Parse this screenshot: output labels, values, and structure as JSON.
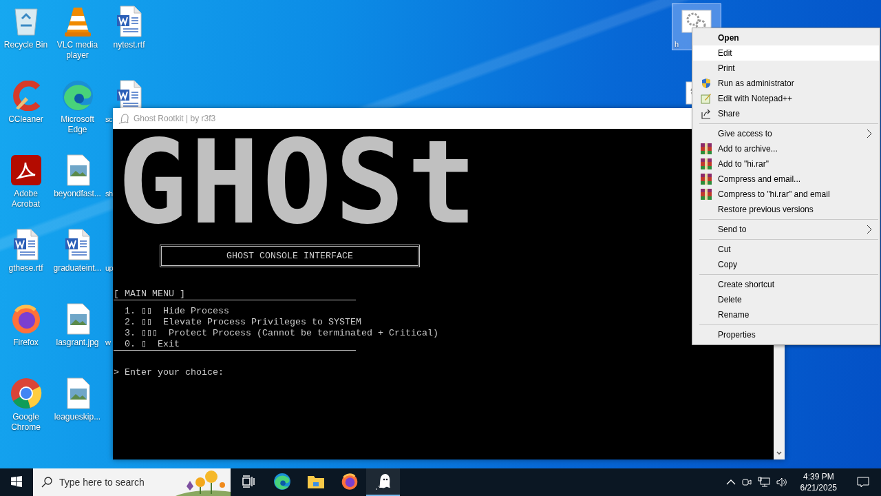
{
  "desktop_icons": [
    {
      "label": "Recycle Bin",
      "kind": "recycle",
      "cut": false
    },
    {
      "label": "CCleaner",
      "kind": "ccleaner",
      "cut": false
    },
    {
      "label": "Adobe Acrobat",
      "kind": "pdf",
      "cut": false
    },
    {
      "label": "gthese.rtf",
      "kind": "word",
      "cut": false
    },
    {
      "label": "Firefox",
      "kind": "firefox",
      "cut": false
    },
    {
      "label": "Google Chrome",
      "kind": "chrome",
      "cut": false
    },
    {
      "label": "VLC media player",
      "kind": "vlc",
      "cut": false
    },
    {
      "label": "Microsoft Edge",
      "kind": "edge",
      "cut": false
    },
    {
      "label": "beyondfast...",
      "kind": "image",
      "cut": false
    },
    {
      "label": "graduateint...",
      "kind": "word",
      "cut": false
    },
    {
      "label": "lasgrant.jpg",
      "kind": "image",
      "cut": false
    },
    {
      "label": "leagueskip...",
      "kind": "image",
      "cut": false
    },
    {
      "label": "nytest.rtf",
      "kind": "word",
      "cut": false
    },
    {
      "label": "sc",
      "kind": "word",
      "cut": true
    },
    {
      "label": "sh",
      "kind": "none",
      "cut": true
    },
    {
      "label": "up",
      "kind": "none",
      "cut": true
    },
    {
      "label": "w",
      "kind": "none",
      "cut": true
    }
  ],
  "selected_file": {
    "label": "h",
    "selected": true
  },
  "console": {
    "title": "Ghost Rootkit | by r3f3",
    "banner": "GHOSt",
    "header": "GHOST CONSOLE INTERFACE",
    "menu_title": "[ MAIN MENU ]",
    "menu_items": [
      "1. ▯▯  Hide Process",
      "2. ▯▯  Elevate Process Privileges to SYSTEM",
      "3. ▯▯▯  Protect Process (Cannot be terminated + Critical)",
      "0. ▯  Exit"
    ],
    "prompt": "> Enter your choice:"
  },
  "context_menu": {
    "groups": [
      [
        {
          "label": "Open",
          "kind": "plain",
          "bold": true,
          "selected": false,
          "submenu": false
        },
        {
          "label": "Edit",
          "kind": "plain",
          "bold": false,
          "selected": true,
          "submenu": false
        },
        {
          "label": "Print",
          "kind": "plain",
          "bold": false,
          "selected": false,
          "submenu": false
        },
        {
          "label": "Run as administrator",
          "kind": "shield",
          "bold": false,
          "selected": false,
          "submenu": false
        },
        {
          "label": "Edit with Notepad++",
          "kind": "notepad",
          "bold": false,
          "selected": false,
          "submenu": false
        },
        {
          "label": "Share",
          "kind": "share",
          "bold": false,
          "selected": false,
          "submenu": false
        }
      ],
      [
        {
          "label": "Give access to",
          "kind": "plain",
          "bold": false,
          "selected": false,
          "submenu": true
        },
        {
          "label": "Add to archive...",
          "kind": "rar",
          "bold": false,
          "selected": false,
          "submenu": false
        },
        {
          "label": "Add to \"hi.rar\"",
          "kind": "rar",
          "bold": false,
          "selected": false,
          "submenu": false
        },
        {
          "label": "Compress and email...",
          "kind": "rar",
          "bold": false,
          "selected": false,
          "submenu": false
        },
        {
          "label": "Compress to \"hi.rar\" and email",
          "kind": "rar",
          "bold": false,
          "selected": false,
          "submenu": false
        },
        {
          "label": "Restore previous versions",
          "kind": "plain",
          "bold": false,
          "selected": false,
          "submenu": false
        }
      ],
      [
        {
          "label": "Send to",
          "kind": "plain",
          "bold": false,
          "selected": false,
          "submenu": true
        }
      ],
      [
        {
          "label": "Cut",
          "kind": "plain",
          "bold": false,
          "selected": false,
          "submenu": false
        },
        {
          "label": "Copy",
          "kind": "plain",
          "bold": false,
          "selected": false,
          "submenu": false
        }
      ],
      [
        {
          "label": "Create shortcut",
          "kind": "plain",
          "bold": false,
          "selected": false,
          "submenu": false
        },
        {
          "label": "Delete",
          "kind": "plain",
          "bold": false,
          "selected": false,
          "submenu": false
        },
        {
          "label": "Rename",
          "kind": "plain",
          "bold": false,
          "selected": false,
          "submenu": false
        }
      ],
      [
        {
          "label": "Properties",
          "kind": "plain",
          "bold": false,
          "selected": false,
          "submenu": false
        }
      ]
    ]
  },
  "taskbar": {
    "search": {
      "placeholder": "Type here to search"
    },
    "apps": [
      {
        "kind": "taskview",
        "active": false
      },
      {
        "kind": "edge",
        "active": false
      },
      {
        "kind": "explorer",
        "active": false
      },
      {
        "kind": "firefox",
        "active": false
      },
      {
        "kind": "ghost",
        "active": true
      }
    ],
    "time": "4:39 PM",
    "date": "6/21/2025"
  }
}
